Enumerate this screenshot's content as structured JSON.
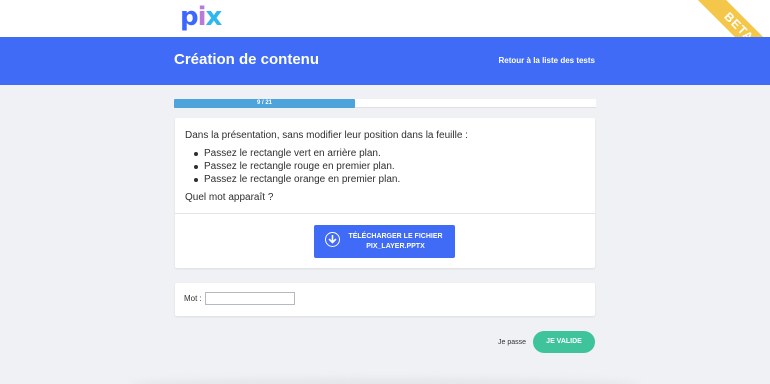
{
  "header": {
    "logo": {
      "p": "p",
      "i": "i",
      "x": "x"
    },
    "ribbon": "BETA"
  },
  "banner": {
    "title": "Création de contenu",
    "back_link": "Retour à la liste des tests"
  },
  "progress": {
    "label": "9 / 21",
    "current": 9,
    "total": 21
  },
  "challenge": {
    "instruction": "Dans la présentation, sans modifier leur position dans la feuille :",
    "items": [
      "Passez le rectangle vert en arrière plan.",
      "Passez le rectangle rouge en premier plan.",
      "Passez le rectangle orange en premier plan."
    ],
    "question": "Quel mot apparaît ?",
    "download": {
      "line1": "TÉLÉCHARGER LE FICHIER",
      "line2": "PIX_LAYER.PPTX",
      "icon": "download-icon"
    }
  },
  "answer": {
    "label": "Mot :",
    "value": "",
    "placeholder": ""
  },
  "actions": {
    "skip": "Je passe",
    "validate": "JE VALIDE"
  },
  "colors": {
    "brand_blue": "#3f6bf6",
    "progress": "#4ea3db",
    "validate_green": "#3fc39b",
    "ribbon_yellow": "#f4c74a",
    "background": "#eff1f4"
  }
}
